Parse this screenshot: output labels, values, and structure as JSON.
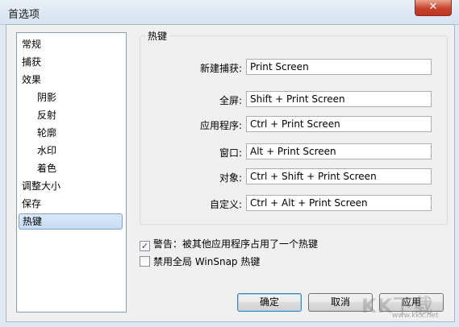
{
  "window": {
    "title": "首选项",
    "close_label": "✕"
  },
  "sidebar": {
    "items": [
      {
        "label": "常规"
      },
      {
        "label": "捕获"
      },
      {
        "label": "效果"
      },
      {
        "label": "阴影"
      },
      {
        "label": "反射"
      },
      {
        "label": "轮廓"
      },
      {
        "label": "水印"
      },
      {
        "label": "着色"
      },
      {
        "label": "调整大小"
      },
      {
        "label": "保存"
      },
      {
        "label": "热键"
      }
    ],
    "selected": "热键"
  },
  "hotkeys": {
    "group_title": "热键",
    "rows": [
      {
        "label": "新建捕获:",
        "value": "Print Screen"
      },
      {
        "label": "全屏:",
        "value": "Shift + Print Screen"
      },
      {
        "label": "应用程序:",
        "value": "Ctrl + Print Screen"
      },
      {
        "label": "窗口:",
        "value": "Alt + Print Screen"
      },
      {
        "label": "对象:",
        "value": "Ctrl + Shift + Print Screen"
      },
      {
        "label": "自定义:",
        "value": "Ctrl + Alt + Print Screen"
      }
    ]
  },
  "options": {
    "warn_label": "警告：被其他应用程序占用了一个热键",
    "warn_checked": true,
    "disable_label": "禁用全局 WinSnap 热键",
    "disable_checked": false
  },
  "buttons": {
    "ok": "确定",
    "cancel": "取消",
    "apply": "应用"
  },
  "watermark": {
    "logo_text": "KK下载",
    "url": "www.kkx.net"
  }
}
